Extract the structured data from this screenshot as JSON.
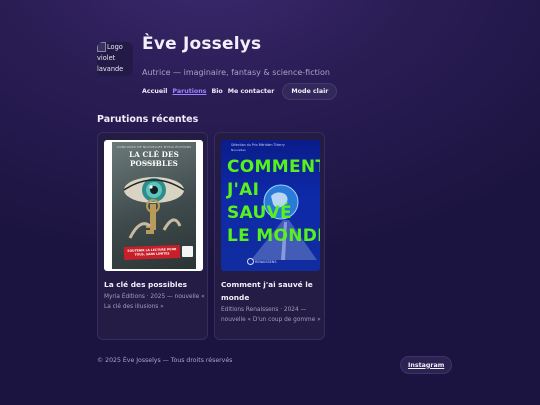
{
  "header": {
    "logo_alt": "Logo violet lavande",
    "site_title": "Ève Josselys",
    "tagline": "Autrice — imaginaire, fantasy & science-fiction",
    "nav": [
      {
        "label": "Accueil",
        "active": false
      },
      {
        "label": "Parutions",
        "active": true
      },
      {
        "label": "Bio",
        "active": false
      },
      {
        "label": "Me contacter",
        "active": false
      }
    ],
    "mode_button": "Mode clair"
  },
  "main": {
    "section_title": "Parutions récentes",
    "books": [
      {
        "title": "La clé des possibles",
        "meta": "Myria Éditions · 2025 — nouvelle « La clé des illusions »",
        "cover": {
          "top_line": "CONCOURS DE NOUVELLES MYRIA ÉDITIONS",
          "title": "LA CLÉ DES POSSIBLES",
          "subtitle": "Anthologie",
          "band": "SOUTENIR LA LECTURE POUR TOUS, SANS LIMITES"
        }
      },
      {
        "title": "Comment j'ai sauvé le monde",
        "meta": "Editions Renaissens · 2024 — nouvelle « D'un coup de gomme »",
        "cover": {
          "series": "Sélection du Prix Méridien Thierry",
          "series_sub": "Nouvelles",
          "lines": [
            "COMMENT",
            "J'AI",
            "SAUVÉ",
            "LE MONDE"
          ],
          "publisher": "RENAISSENS"
        }
      }
    ]
  },
  "footer": {
    "copyright": "© 2025 Ève Josselys — Tous droits réservés",
    "instagram_button": "Instagram"
  },
  "colors": {
    "background": "#2a1d55",
    "accent": "#9b84ff",
    "cover2_text": "#57f21c"
  }
}
